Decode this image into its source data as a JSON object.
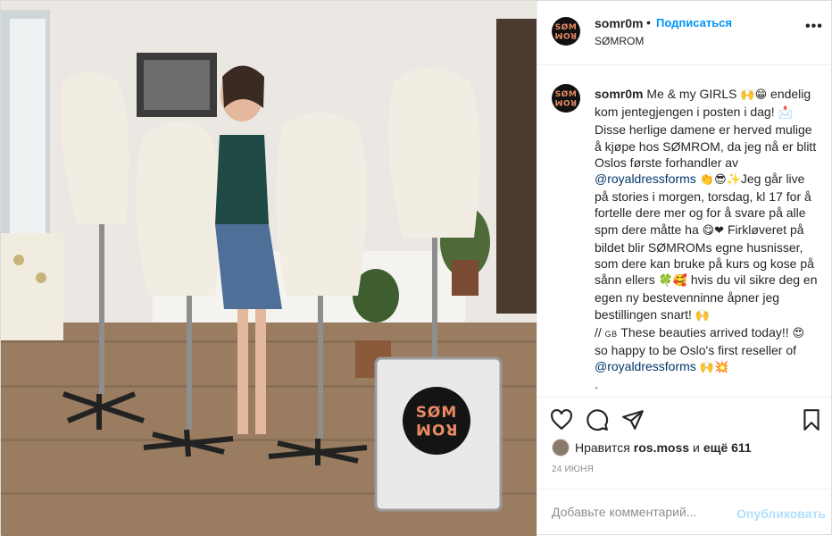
{
  "header": {
    "username": "somr0m",
    "separator": "•",
    "follow_label": "Подписаться",
    "subtitle": "SØMROM",
    "more_label": "•••"
  },
  "avatar": {
    "top_text": "SØM",
    "bottom_text": "ROM"
  },
  "caption": {
    "username": "somr0m",
    "part1": " Me & my GIRLS ",
    "emoji1": "🙌😁",
    "part2": " endelig kom jentegjengen i posten i dag! ",
    "emoji2": "📩",
    "part3": " Disse herlige damene er herved mulige å kjøpe hos SØMROM, da jeg nå er blitt Oslos første forhandler av ",
    "mention1": "@royaldressforms",
    "emoji3": " 👏😎",
    "emoji4": "✨",
    "part4": "Jeg går live på stories i morgen, torsdag, kl 17 for å fortelle dere mer og for å svare på alle spm dere måtte ha ",
    "emoji5": "😋❤",
    "part5": " Firkløveret på bildet blir SØMROMs egne husnisser, som dere kan bruke på kurs og kose på sånn ellers ",
    "emoji6": "🍀🥰",
    "part6": " hvis du vil sikre deg en egen ny bestevenninne åpner jeg bestillingen snart! ",
    "emoji7": "🙌",
    "part7": "// ",
    "gb": "GB",
    "part8": " These beauties arrived today!! ",
    "emoji8": "😍",
    "part9": " so happy to be Oslo's first reseller of ",
    "mention2": "@royaldressforms",
    "emoji9": " 🙌💥",
    "part10": "."
  },
  "likes": {
    "prefix": "Нравится",
    "user": "ros.moss",
    "middle": "и",
    "count_text": "ещё 611"
  },
  "date": "24 июня",
  "comment": {
    "placeholder": "Добавьте комментарий...",
    "publish_label": "Опубликовать"
  },
  "sign": {
    "top_text": "SØM",
    "bottom_text": "ROM"
  },
  "colors": {
    "link_blue": "#0095f6",
    "mention": "#00376b",
    "publish_disabled": "#b2dffc",
    "muted": "#8e8e8e",
    "logo_orange": "#e78a63"
  },
  "icons": [
    "heart-icon",
    "comment-icon",
    "share-icon",
    "bookmark-icon",
    "more-icon"
  ]
}
